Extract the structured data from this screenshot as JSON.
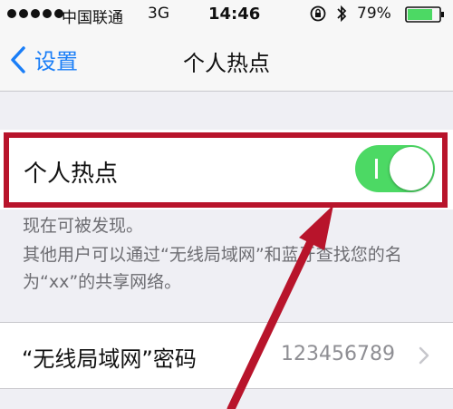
{
  "status_bar": {
    "carrier": "中国联通",
    "network": "3G",
    "time": "14:46",
    "battery": "79%",
    "icons": [
      "signal-dots",
      "rotation-lock-icon",
      "bluetooth-icon",
      "battery-icon"
    ]
  },
  "nav": {
    "back_label": "设置",
    "title": "个人热点"
  },
  "hotspot": {
    "label": "个人热点",
    "enabled": true
  },
  "notes": {
    "discoverable": "现在可被发现。",
    "description": "其他用户可以通过“无线局域网”和蓝牙查找您的名为“xx”的共享网络。"
  },
  "password_row": {
    "label": "“无线局域网”密码",
    "value": "123456789"
  },
  "colors": {
    "accent": "#1a7ef7",
    "toggle_on": "#4cd964",
    "highlight": "#b8142b",
    "background": "#efeff4"
  }
}
